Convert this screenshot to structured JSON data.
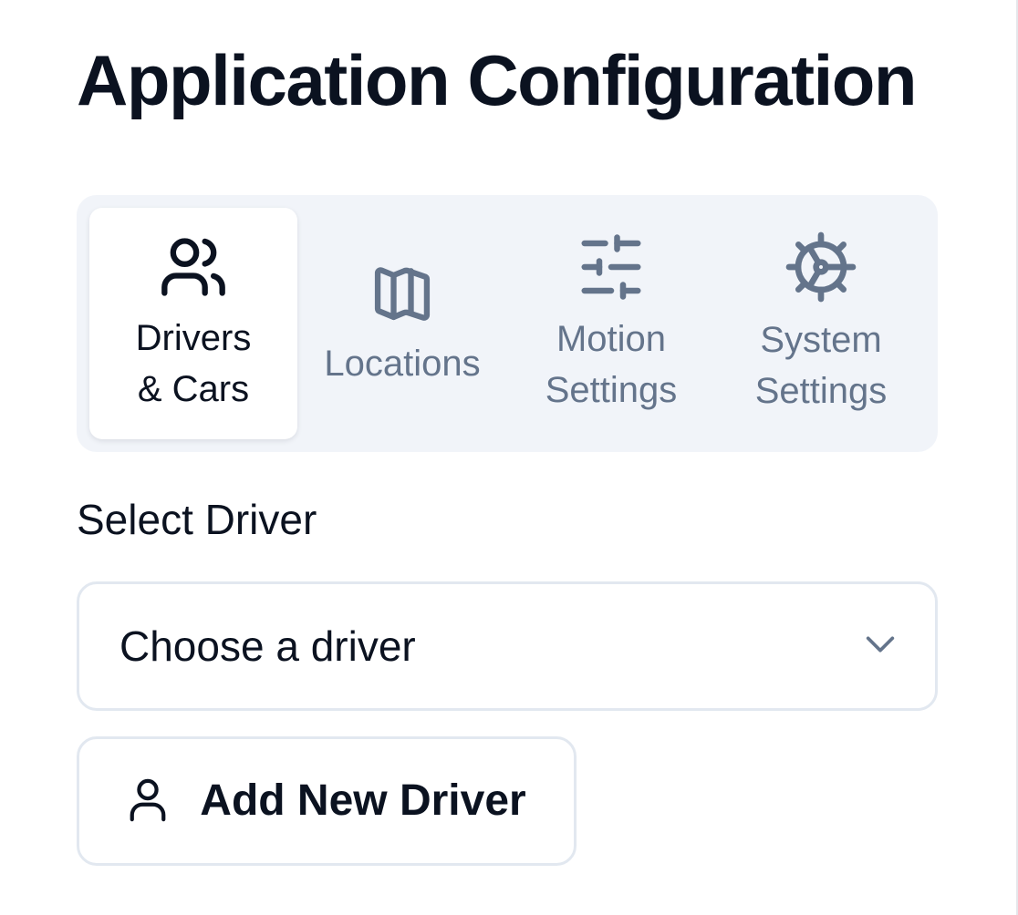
{
  "page": {
    "title": "Application Configuration"
  },
  "tabs": [
    {
      "label": "Drivers\n& Cars",
      "icon": "users-icon",
      "active": true
    },
    {
      "label": "Locations",
      "icon": "map-icon",
      "active": false
    },
    {
      "label": "Motion\nSettings",
      "icon": "sliders-icon",
      "active": false
    },
    {
      "label": "System\nSettings",
      "icon": "gear-icon",
      "active": false
    }
  ],
  "driver_section": {
    "label": "Select Driver",
    "select_value": "Choose a driver",
    "add_button_label": "Add New Driver"
  },
  "colors": {
    "text_primary": "#0b1220",
    "text_muted": "#64748b",
    "tabs_background": "#f1f4f9",
    "border": "#e2e8f0",
    "background": "#ffffff"
  }
}
